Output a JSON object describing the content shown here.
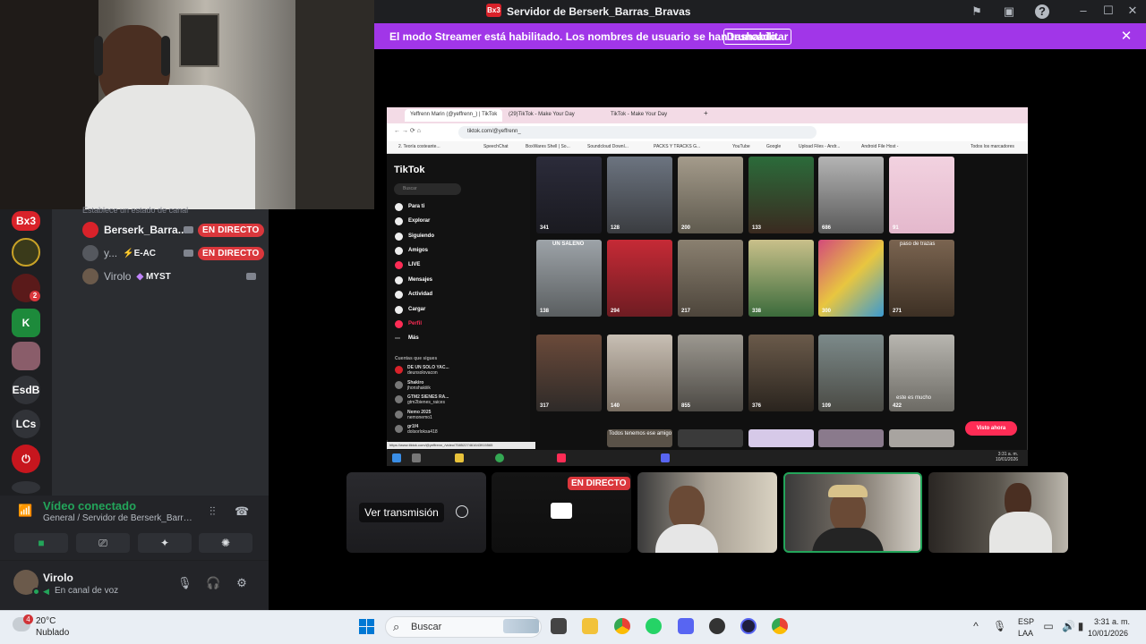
{
  "window": {
    "title": "Servidor de Berserk_Barras_Bravas",
    "app_badge": "Bx3"
  },
  "banner": {
    "text": "El modo Streamer está habilitado. Los nombres de usuario se han truncado.",
    "button": "Deshabilitar",
    "color": "#a136e8"
  },
  "servers": [
    "Bx3",
    "EsdB",
    "LCs"
  ],
  "server_badge_count": "2",
  "voice_channel": {
    "header_fragment": "Establece un estado de canal",
    "users": [
      {
        "name": "Berserk_Barra...",
        "badge": "EN DIRECTO"
      },
      {
        "name": "y...",
        "tag": "E-AC",
        "badge": "EN DIRECTO"
      },
      {
        "name": "Virolo",
        "tag": "MYST"
      }
    ]
  },
  "voice_panel": {
    "title": "Vídeo conectado",
    "subtitle": "General / Servidor de Berserk_Barras_..."
  },
  "user_panel": {
    "name": "Virolo",
    "status": "En canal de voz"
  },
  "stream": {
    "browser": {
      "tabs": [
        "Yeffrenn Marin (@yeffrenn_) | TikTok",
        "(29)TikTok - Make Your Day",
        "TikTok - Make Your Day"
      ],
      "url": "tiktok.com/@yeffrenn_",
      "bookmarks": [
        "2. Teoría costeante...",
        "SpeechChat",
        "BoxWares Shell | So...",
        "Soundcloud Downl...",
        "PACKS Y TRACKS G...",
        "YouTube",
        "Google",
        "Upload Files - Andr...",
        "Android File Host -",
        "Todos los marcadores"
      ],
      "status_url": "https://www.tiktok.com/@yeffrenn_/video/7585227461643915565",
      "clock_time": "3:31 a. m.",
      "clock_date": "10/01/2026"
    },
    "tiktok": {
      "logo": "TikTok",
      "search_placeholder": "Buscar",
      "nav": [
        "Para ti",
        "Explorar",
        "Siguiendo",
        "Amigos",
        "LIVE",
        "Mensajes",
        "Actividad",
        "Cargar",
        "Perfil",
        "Más"
      ],
      "following_header": "Cuentas que sigues",
      "following": [
        {
          "name": "DE UN SOLO YAC...",
          "handle": "deunsolovacon"
        },
        {
          "name": "Shakiro",
          "handle": "jhonshakiiik"
        },
        {
          "name": "GTM2 SIENES RA...",
          "handle": "gtm2bienes_raices"
        },
        {
          "name": "Nemo 2025",
          "handle": "nemonemo1"
        },
        {
          "name": "gr1f4",
          "handle": "dolsorloksa418"
        }
      ],
      "views": [
        "341",
        "128",
        "200",
        "133",
        "686",
        "91",
        "138",
        "294",
        "217",
        "338",
        "300",
        "271",
        "317",
        "140",
        "855",
        "376",
        "109",
        "422"
      ],
      "thumb_captions": [
        "UN SALENO",
        "paso de trazas",
        "Todos tenemos ese amigo",
        "este es mucho"
      ],
      "cta": "Visto ahora"
    }
  },
  "tiles": {
    "watch_button": "Ver transmisión",
    "live_badge": "EN DIRECTO"
  },
  "taskbar": {
    "weather_badge": "4",
    "temperature": "20°C",
    "condition": "Nublado",
    "search": "Buscar",
    "lang1": "ESP",
    "lang2": "LAA",
    "time": "3:31 a. m.",
    "date": "10/01/2026"
  },
  "colors": {
    "live_red": "#da373c",
    "connected_green": "#23a55a",
    "tiktok_pink": "#fe2c55"
  }
}
